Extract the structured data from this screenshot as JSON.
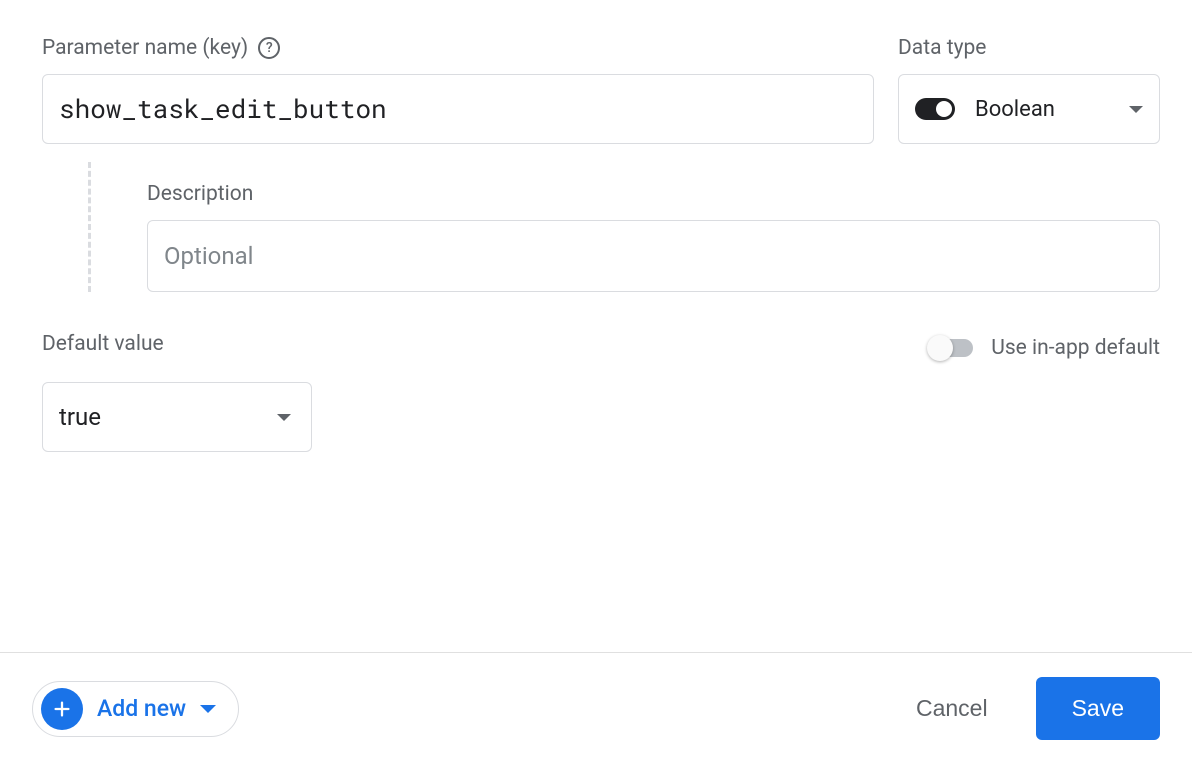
{
  "labels": {
    "parameter_name": "Parameter name (key)",
    "data_type": "Data type",
    "description": "Description",
    "default_value": "Default value",
    "use_in_app_default": "Use in-app default"
  },
  "parameter_name": {
    "value": "show_task_edit_button"
  },
  "data_type": {
    "selected": "Boolean"
  },
  "description": {
    "value": "",
    "placeholder": "Optional"
  },
  "default_value": {
    "selected": "true"
  },
  "use_in_app_default": {
    "enabled": false
  },
  "footer": {
    "add_new": "Add new",
    "cancel": "Cancel",
    "save": "Save"
  }
}
